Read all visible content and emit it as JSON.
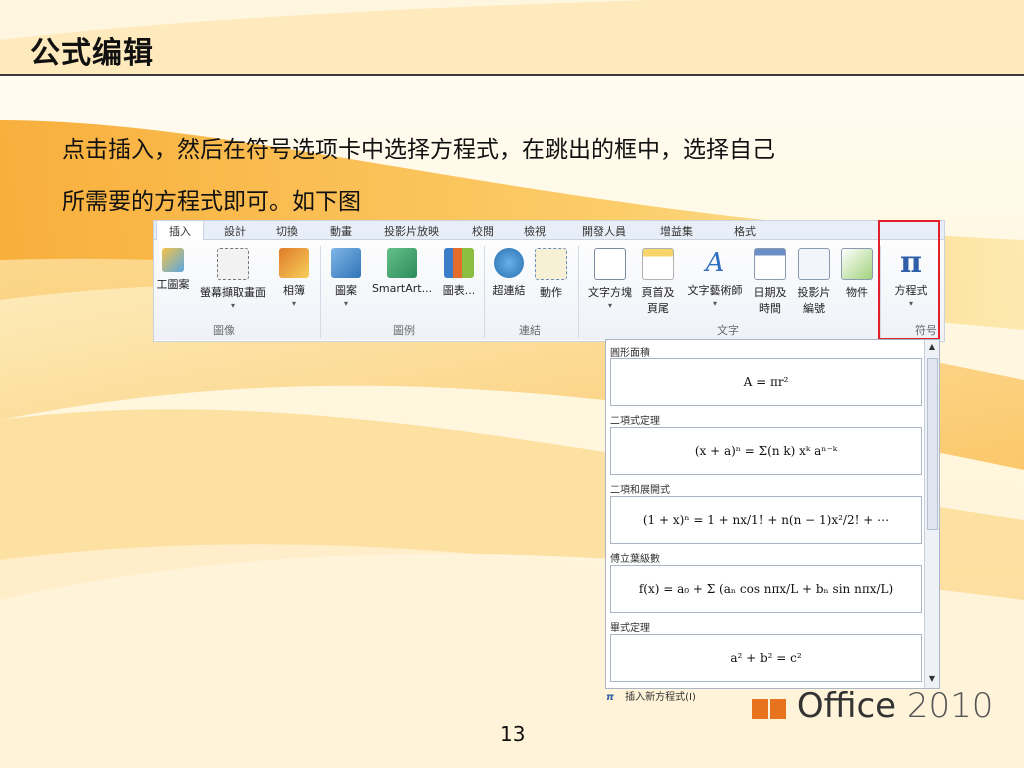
{
  "slide": {
    "title": "公式编辑",
    "body_line1": "点击插入，然后在符号选项卡中选择方程式，在跳出的框中，选择自己",
    "body_line2": "所需要的方程式即可。如下图",
    "page_number": "13"
  },
  "ribbon": {
    "tabs": [
      "插入",
      "設計",
      "切換",
      "動畫",
      "投影片放映",
      "校閱",
      "檢視",
      "開發人員",
      "增益集",
      "格式"
    ],
    "active_tab": "插入",
    "buttons": {
      "clipart": "工圖案",
      "screenshot": "螢幕擷取畫面",
      "album": "相簿",
      "shapes": "圖案",
      "smartart": "SmartArt...",
      "chart": "圖表...",
      "hyperlink": "超連結",
      "action": "動作",
      "textbox": "文字方塊",
      "header_footer_1": "頁首及",
      "header_footer_2": "頁尾",
      "wordart": "文字藝術師",
      "datetime_1": "日期及",
      "datetime_2": "時間",
      "slide_number_1": "投影片",
      "slide_number_2": "編號",
      "object": "物件",
      "equation": "方程式"
    },
    "groups": {
      "images": "圖像",
      "illustrations": "圖例",
      "links": "連結",
      "text": "文字",
      "symbols": "符号"
    }
  },
  "gallery": {
    "items": [
      {
        "header": "圓形面積",
        "formula": "A = πr²"
      },
      {
        "header": "二項式定理",
        "formula": "(x + a)ⁿ = Σ(n k) xᵏ aⁿ⁻ᵏ"
      },
      {
        "header": "二項和展開式",
        "formula": "(1 + x)ⁿ = 1 + nx/1! + n(n − 1)x²/2! + ⋯"
      },
      {
        "header": "傅立葉級數",
        "formula": "f(x) = a₀ + Σ (aₙ cos nπx/L + bₙ sin nπx/L)"
      },
      {
        "header": "畢式定理",
        "formula": "a² + b² = c²"
      }
    ],
    "insert_new": "插入新方程式(I)"
  },
  "logo": {
    "text": "Office",
    "year": "2010"
  },
  "colors": {
    "accent_red": "#e0202a",
    "title_rule": "#3b3b3b"
  }
}
